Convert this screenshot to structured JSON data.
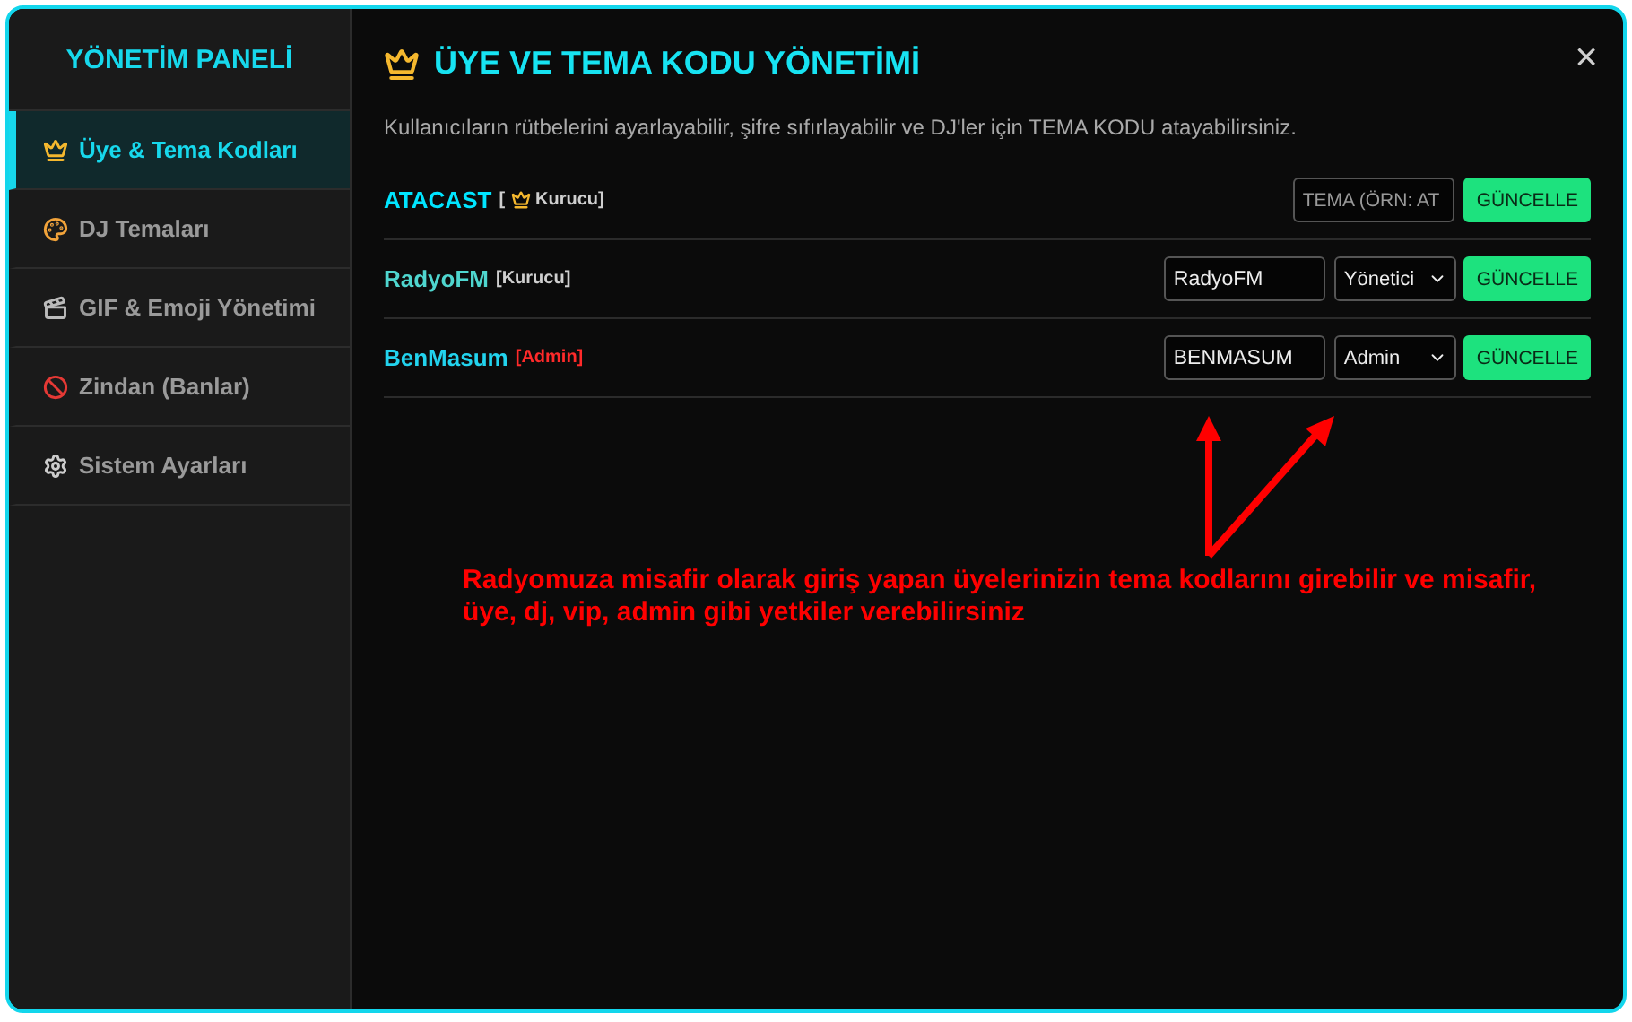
{
  "sidebar": {
    "title": "YÖNETİM PANELİ",
    "items": [
      {
        "label": "Üye & Tema Kodları",
        "kind": "crown",
        "selected": true
      },
      {
        "label": "DJ Temaları",
        "kind": "palette",
        "selected": false
      },
      {
        "label": "GIF & Emoji Yönetimi",
        "kind": "clapper",
        "selected": false
      },
      {
        "label": "Zindan (Banlar)",
        "kind": "ban",
        "selected": false
      },
      {
        "label": "Sistem Ayarları",
        "kind": "gear",
        "selected": false
      }
    ]
  },
  "panel": {
    "title": "ÜYE VE TEMA KODU YÖNETİMİ",
    "close": "×",
    "description": "Kullanıcıların rütbelerini ayarlayabilir, şifre sıfırlayabilir ve DJ'ler için TEMA KODU atayabilirsiniz.",
    "members": [
      {
        "name": "ATACAST",
        "color": "#00e5ff",
        "tag": {
          "open": "[",
          "label": "Kurucu",
          "close": "]",
          "crown": true,
          "color": "#cfcfcf"
        },
        "code": {
          "placeholder": "TEMA (ÖRN: AT"
        },
        "button": "GÜNCELLE"
      },
      {
        "name": "RadyoFM",
        "color": "#4fd6cf",
        "tag": {
          "open": "[",
          "label": "Kurucu",
          "close": "]",
          "crown": false,
          "color": "#cfcfcf"
        },
        "code": {
          "value": "RadyoFM"
        },
        "role": "Yönetici",
        "button": "GÜNCELLE"
      },
      {
        "name": "BenMasum",
        "color": "#22d3ee",
        "tag": {
          "open": "[",
          "label": "Admin",
          "close": "]",
          "crown": false,
          "color": "#ff2a2a"
        },
        "code": {
          "value": "BENMASUM"
        },
        "role": "Admin",
        "button": "GÜNCELLE"
      }
    ]
  },
  "annotation": {
    "text": "Radyomuza misafir olarak giriş yapan üyelerinizin tema kodlarını girebilir ve misafir, üye, dj, vip, admin gibi yetkiler verebilirsiniz"
  }
}
